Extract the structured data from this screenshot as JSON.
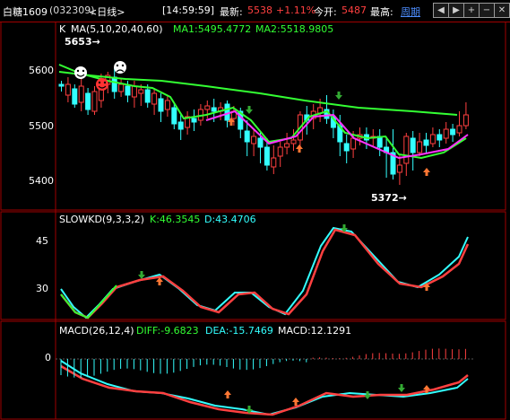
{
  "header": {
    "symbol": "白糖1609",
    "code": "(032309)",
    "period": "<日线>",
    "time": "[14:59:59]",
    "latest_label": "最新:",
    "latest_value": "5538",
    "change_pct": "+1.11%",
    "open_label": "今开:",
    "open_value": "5487",
    "high_label": "最高:",
    "period_button": "周期",
    "nav_icons": [
      "arrow-left-icon",
      "arrow-right-icon",
      "zoom-in-icon",
      "zoom-out-icon",
      "close-icon"
    ]
  },
  "colors": {
    "up": "#ff4040",
    "down": "#33ffff",
    "ma1": "#ffffff",
    "ma2": "#ffff00",
    "green_line": "#33ff33",
    "magenta": "#ff33ff",
    "border": "#a00000"
  },
  "panels": {
    "main": {
      "label_k": "K",
      "ma_label": "MA(5,10,20,40,60)",
      "ma1_text": "MA1:5495.4772",
      "ma2_text": "MA2:5518.9805",
      "yticks": [
        "5600",
        "5500",
        "5400"
      ],
      "high_annotation": "5653→",
      "low_annotation": "5372→",
      "icons": [
        "smiley-icon",
        "smiley-icon",
        "frown-icon"
      ]
    },
    "slowkd": {
      "label": "SLOWKD(9,3,3,2)",
      "k_text": "K:46.3545",
      "d_text": "D:43.4706",
      "yticks": [
        "45",
        "30"
      ]
    },
    "macd": {
      "label": "MACD(26,12,4)",
      "diff_text": "DIFF:-9.6823",
      "dea_text": "DEA:-15.7469",
      "macd_text": "MACD:12.1291",
      "yticks": [
        "0"
      ]
    }
  }
}
